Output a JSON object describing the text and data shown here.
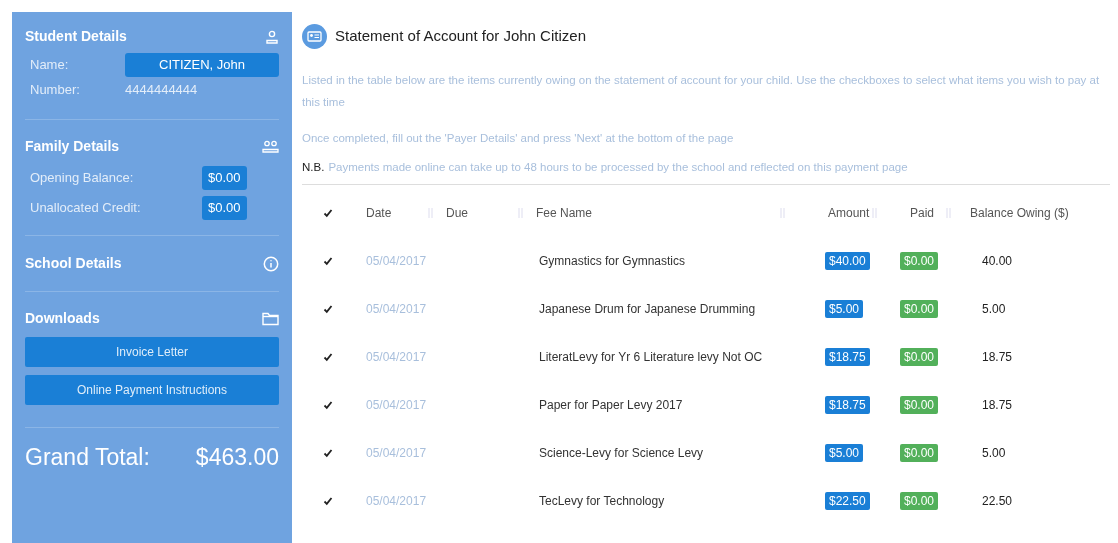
{
  "sidebar": {
    "student": {
      "title": "Student Details",
      "name_label": "Name:",
      "name": "CITIZEN, John",
      "number_label": "Number:",
      "number": "4444444444"
    },
    "family": {
      "title": "Family Details",
      "rows": [
        {
          "label": "Opening Balance:",
          "value": "$0.00"
        },
        {
          "label": "Unallocated Credit:",
          "value": "$0.00"
        }
      ]
    },
    "school": {
      "title": "School Details"
    },
    "downloads": {
      "title": "Downloads",
      "buttons": [
        "Invoice Letter",
        "Online Payment Instructions"
      ]
    },
    "grand_total": {
      "label": "Grand Total:",
      "value": "$463.00"
    }
  },
  "main": {
    "title": "Statement of Account for John Citizen",
    "paragraphs": [
      "Listed in the table below are the items currently owing on the statement of account for your child. Use the checkboxes to select what items you wish to pay at this time",
      "Once completed, fill out the 'Payer Details' and press 'Next' at the bottom of the page"
    ],
    "note": {
      "label": "N.B.",
      "text": "Payments made online can take up to 48 hours to be processed by the school and reflected on this payment page"
    },
    "table": {
      "select_all": {
        "checked": true
      },
      "columns": [
        "Date",
        "Due",
        "Fee Name",
        "Amount",
        "Paid",
        "Balance Owing ($)"
      ],
      "rows": [
        {
          "checked": true,
          "date": "05/04/2017",
          "fee_name": "Gymnastics for Gymnastics",
          "amount": "$40.00",
          "paid": "$0.00",
          "balance": "40.00"
        },
        {
          "checked": true,
          "date": "05/04/2017",
          "fee_name": "Japanese Drum for Japanese Drumming",
          "amount": "$5.00",
          "paid": "$0.00",
          "balance": "5.00"
        },
        {
          "checked": true,
          "date": "05/04/2017",
          "fee_name": "LiteratLevy for Yr 6 Literature levy Not OC",
          "amount": "$18.75",
          "paid": "$0.00",
          "balance": "18.75"
        },
        {
          "checked": true,
          "date": "05/04/2017",
          "fee_name": "Paper for Paper Levy 2017",
          "amount": "$18.75",
          "paid": "$0.00",
          "balance": "18.75"
        },
        {
          "checked": true,
          "date": "05/04/2017",
          "fee_name": "Science-Levy for Science Levy",
          "amount": "$5.00",
          "paid": "$0.00",
          "balance": "5.00"
        },
        {
          "checked": true,
          "date": "05/04/2017",
          "fee_name": "TecLevy for Technology",
          "amount": "$22.50",
          "paid": "$0.00",
          "balance": "22.50"
        }
      ]
    }
  }
}
